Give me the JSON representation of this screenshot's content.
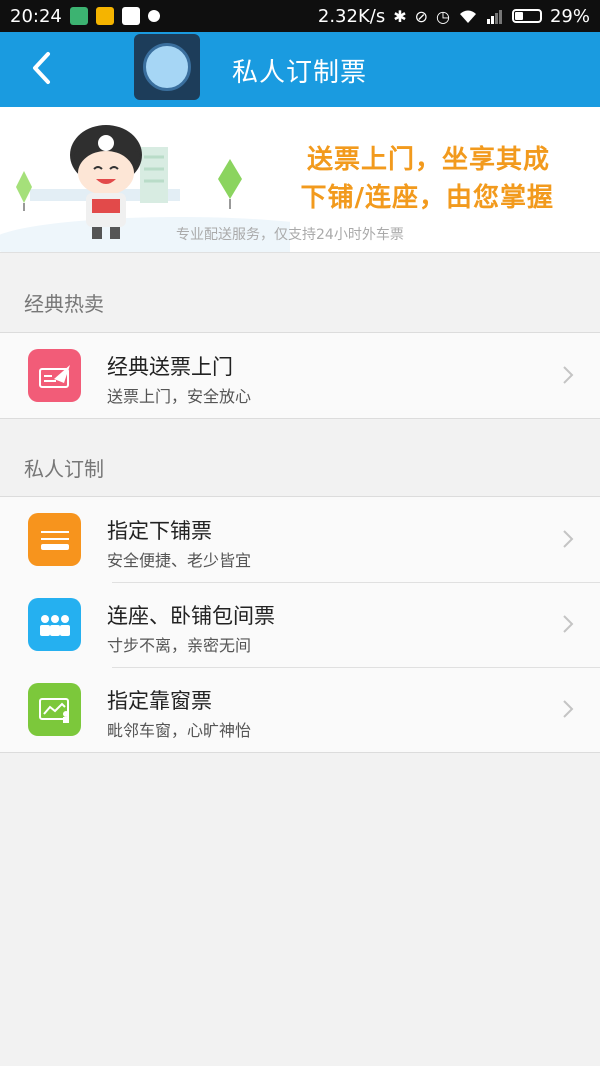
{
  "status_bar": {
    "time": "20:24",
    "network_speed": "2.32K/s",
    "battery_percent": "29%",
    "battery_level": 0.29,
    "icons": [
      "app-notification-icon",
      "game-icon",
      "qq-icon",
      "dot-icon",
      "bluetooth-icon",
      "mute-icon",
      "alarm-icon",
      "wifi-icon",
      "signal-icon",
      "battery-icon"
    ]
  },
  "app_bar": {
    "title": "私人订制票",
    "back_icon": "chevron-left-icon"
  },
  "banner": {
    "line1": "送票上门，坐享其成",
    "line2": "下铺/连座，由您掌握",
    "subtitle": "专业配送服务，仅支持24小时外车票",
    "colors": {
      "headline": "#f29a1d"
    }
  },
  "sections": [
    {
      "header": "经典热卖",
      "items": [
        {
          "title": "经典送票上门",
          "subtitle": "送票上门，安全放心",
          "icon": "ticket-delivery-icon",
          "icon_color": "#f25c78"
        }
      ]
    },
    {
      "header": "私人订制",
      "items": [
        {
          "title": "指定下铺票",
          "subtitle": "安全便捷、老少皆宜",
          "icon": "lower-berth-icon",
          "icon_color": "#f7941d"
        },
        {
          "title": "连座、卧铺包间票",
          "subtitle": "寸步不离，亲密无间",
          "icon": "group-seats-icon",
          "icon_color": "#25b0f0"
        },
        {
          "title": "指定靠窗票",
          "subtitle": "毗邻车窗，心旷神怡",
          "icon": "window-seat-icon",
          "icon_color": "#7cc83b"
        }
      ]
    }
  ],
  "colors": {
    "app_bar": "#1a9be0",
    "background": "#f2f2f2"
  }
}
